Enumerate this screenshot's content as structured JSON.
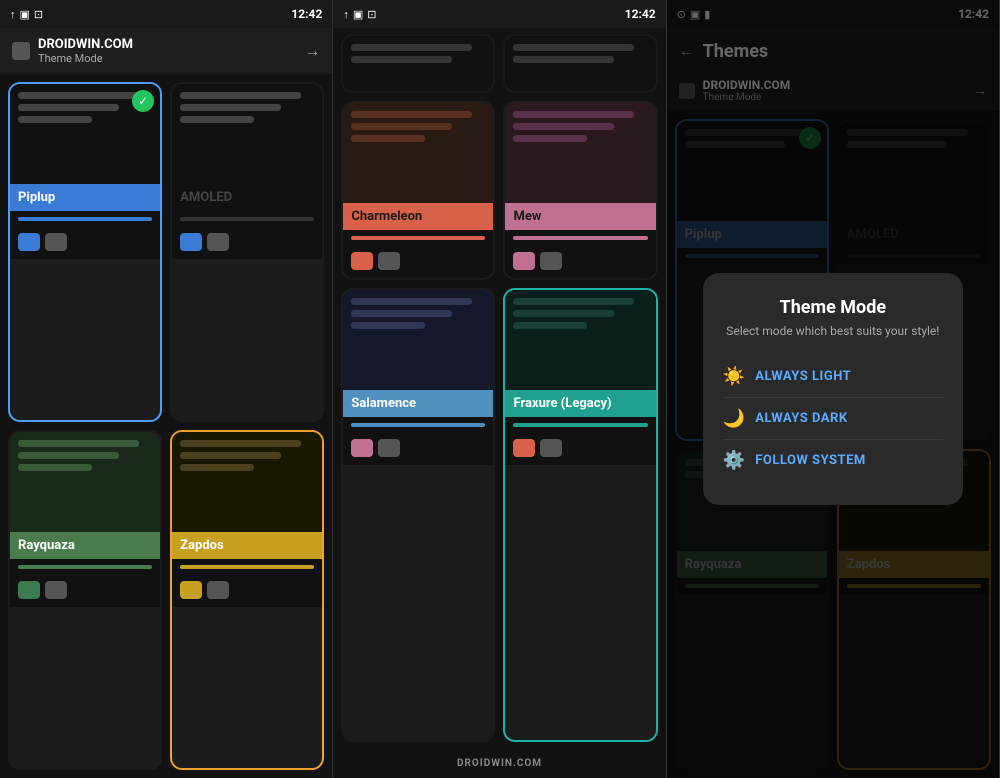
{
  "panels": {
    "left": {
      "status": {
        "time": "12:42"
      },
      "header": {
        "brand": "DROIDWIN.COM",
        "subtitle": "Theme Mode",
        "arrow": "→"
      },
      "themes": [
        {
          "id": "piplup",
          "label": "Piplup",
          "label_class": "blue-bg",
          "accent_class": "accent-blue",
          "selected": true,
          "swatches": [
            "#3a7bd5",
            "#555"
          ],
          "card_class": "selected-blue"
        },
        {
          "id": "amoled",
          "label": "AMOLED",
          "label_class": "black-bg",
          "accent_class": "accent-dark",
          "selected": false,
          "swatches": [
            "#3a7bd5",
            "#555"
          ],
          "card_class": ""
        },
        {
          "id": "rayquaza",
          "label": "Rayquaza",
          "label_class": "green-bg",
          "accent_class": "accent-green",
          "selected": false,
          "swatches": [
            "#3a7c4e",
            "#555"
          ],
          "card_class": ""
        },
        {
          "id": "zapdos",
          "label": "Zapdos",
          "label_class": "yellow-bg",
          "accent_class": "accent-yellow",
          "selected": false,
          "swatches": [
            "#c8a020",
            "#555"
          ],
          "card_class": "selected-orange"
        }
      ]
    },
    "middle": {
      "status": {
        "time": "12:42"
      },
      "brand_bottom": "DROIDWIN.COM",
      "themes": [
        {
          "id": "charmeleon",
          "label": "Charmeleon",
          "label_class": "coral-bg",
          "accent_class": "accent-coral",
          "swatches": [
            "#d9604a",
            "#555"
          ],
          "card_class": ""
        },
        {
          "id": "mew",
          "label": "Mew",
          "label_class": "pink-bg",
          "accent_class": "accent-pink",
          "swatches": [
            "#c07090",
            "#555"
          ],
          "card_class": ""
        },
        {
          "id": "salamence",
          "label": "Salamence",
          "label_class": "lightblue-bg",
          "accent_class": "accent-lb",
          "swatches": [
            "#c07090",
            "#555"
          ],
          "card_class": ""
        },
        {
          "id": "fraxure",
          "label": "Fraxure (Legacy)",
          "label_class": "teal-bg",
          "accent_class": "accent-teal",
          "swatches": [
            "#d9604a",
            "#555"
          ],
          "card_class": "selected-teal"
        }
      ]
    },
    "right": {
      "status": {
        "time": "12:42"
      },
      "header": {
        "back": "←",
        "title": "Themes",
        "brand": "DROIDWIN.COM",
        "subtitle": "Theme Mode",
        "arrow": "→"
      },
      "themes": [
        {
          "id": "piplup",
          "label": "Piplup",
          "label_class": "blue-bg",
          "accent_class": "accent-blue",
          "selected": true,
          "card_class": "selected-blue"
        },
        {
          "id": "amoled",
          "label": "AMOLED",
          "label_class": "black-bg",
          "accent_class": "accent-dark",
          "selected": false,
          "card_class": ""
        },
        {
          "id": "rayquaza",
          "label": "Rayquaza",
          "label_class": "green-bg",
          "accent_class": "accent-green",
          "card_class": ""
        },
        {
          "id": "zapdos",
          "label": "Zapdos",
          "label_class": "yellow-bg",
          "accent_class": "accent-yellow",
          "card_class": "selected-orange"
        }
      ],
      "modal": {
        "title": "Theme Mode",
        "subtitle": "Select mode which best suits your style!",
        "options": [
          {
            "id": "always-light",
            "icon": "☀️",
            "label": "ALWAYS LIGHT"
          },
          {
            "id": "always-dark",
            "icon": "🌙",
            "label": "ALWAYS DARK"
          },
          {
            "id": "follow-system",
            "icon": "⚙️",
            "label": "FOLLOW SYSTEM"
          }
        ]
      }
    }
  }
}
